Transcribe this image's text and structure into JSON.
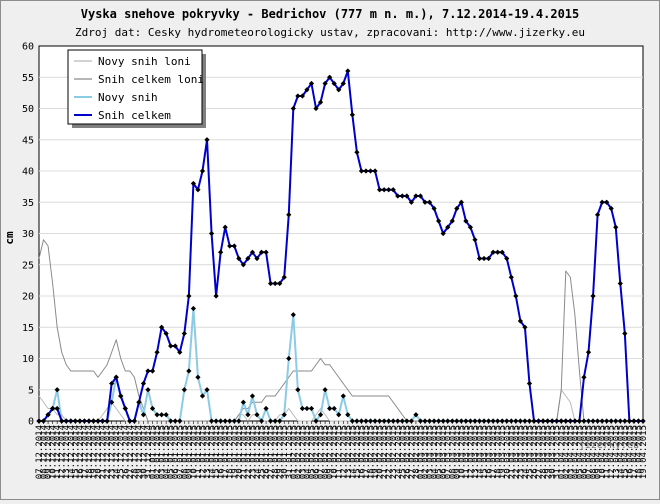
{
  "chart_data": {
    "type": "line",
    "title": "Vyska snehove pokryvky - Bedrichov (777 m n. m.), 7.12.2014-19.4.2015",
    "subtitle": "Zdroj dat: Cesky hydrometeorologicky ustav, zpracovani: http://www.jizerky.eu",
    "ylabel": "cm",
    "xlabel": "",
    "ylim": [
      0,
      60
    ],
    "yticks": [
      0,
      5,
      10,
      15,
      20,
      25,
      30,
      35,
      40,
      45,
      50,
      55,
      60
    ],
    "grid": true,
    "legend_position": "top-left",
    "x_start": "7.12.2014",
    "x_end": "19.4.2015",
    "watermark": "jizerky.eu",
    "legend": [
      {
        "name": "Novy snih loni",
        "color": "#b8b8b8",
        "marker": false
      },
      {
        "name": "Snih celkem loni",
        "color": "#8a8a8a",
        "marker": false
      },
      {
        "name": "Novy snih",
        "color": "#8ccbe6",
        "marker": true
      },
      {
        "name": "Snih celkem",
        "color": "#0000cc",
        "marker": true
      }
    ],
    "series": [
      {
        "name": "Snih celkem",
        "color": "#0000cc",
        "values": [
          0,
          0,
          1,
          2,
          2,
          0,
          0,
          0,
          0,
          0,
          0,
          0,
          0,
          0,
          0,
          0,
          6,
          7,
          4,
          2,
          0,
          0,
          3,
          6,
          8,
          8,
          11,
          15,
          14,
          12,
          12,
          11,
          14,
          20,
          38,
          37,
          40,
          45,
          30,
          20,
          27,
          31,
          28,
          28,
          26,
          25,
          26,
          27,
          26,
          27,
          27,
          22,
          22,
          22,
          23,
          33,
          50,
          52,
          52,
          53,
          54,
          50,
          51,
          54,
          55,
          54,
          53,
          54,
          56,
          49,
          43,
          40,
          40,
          40,
          40,
          37,
          37,
          37,
          37,
          36,
          36,
          36,
          35,
          36,
          36,
          35,
          35,
          34,
          32,
          30,
          31,
          32,
          34,
          35,
          32,
          31,
          29,
          26,
          26,
          26,
          27,
          27,
          27,
          26,
          23,
          20,
          16,
          15,
          6,
          0,
          0,
          0,
          0,
          0,
          0,
          0,
          0,
          0,
          0,
          0,
          7,
          11,
          20,
          33,
          35,
          35,
          34,
          31,
          22,
          14,
          0,
          0,
          0,
          0,
          0,
          0,
          0,
          0,
          0,
          0,
          0,
          0
        ]
      },
      {
        "name": "Novy snih",
        "color": "#8ccbe6",
        "values": [
          0,
          0,
          1,
          2,
          5,
          0,
          0,
          0,
          0,
          0,
          0,
          0,
          0,
          0,
          0,
          0,
          3,
          7,
          4,
          2,
          0,
          0,
          3,
          1,
          5,
          2,
          1,
          1,
          1,
          0,
          0,
          0,
          5,
          8,
          18,
          7,
          4,
          5,
          0,
          0,
          0,
          0,
          0,
          0,
          0,
          3,
          1,
          4,
          1,
          0,
          2,
          0,
          0,
          0,
          1,
          10,
          17,
          5,
          2,
          2,
          2,
          0,
          1,
          5,
          2,
          2,
          1,
          4,
          1,
          0,
          0,
          0,
          0,
          0,
          0,
          0,
          0,
          0,
          0,
          0,
          0,
          0,
          0,
          1,
          0,
          0,
          0,
          0,
          0,
          0,
          0,
          0,
          0,
          0,
          0,
          0,
          0,
          0,
          0,
          0,
          0,
          0,
          0,
          0,
          0,
          0,
          0,
          0,
          0,
          0,
          0,
          0,
          0,
          0,
          0,
          0,
          0,
          0,
          0,
          0,
          0,
          0,
          0,
          0,
          0,
          0,
          0,
          0,
          0,
          0,
          0,
          0,
          0,
          0,
          0,
          0,
          0,
          0,
          0,
          0,
          0,
          0
        ]
      },
      {
        "name": "Snih celkem loni",
        "color": "#8a8a8a",
        "values": [
          26,
          29,
          28,
          22,
          15,
          11,
          9,
          8,
          8,
          8,
          8,
          8,
          8,
          7,
          8,
          9,
          11,
          13,
          10,
          8,
          8,
          7,
          4,
          2,
          0,
          0,
          0,
          0,
          0,
          0,
          0,
          0,
          0,
          0,
          0,
          0,
          0,
          0,
          0,
          0,
          0,
          0,
          0,
          0,
          1,
          2,
          2,
          3,
          3,
          3,
          4,
          4,
          4,
          5,
          6,
          7,
          8,
          8,
          8,
          8,
          8,
          9,
          10,
          9,
          9,
          8,
          7,
          6,
          5,
          4,
          4,
          4,
          4,
          4,
          4,
          4,
          4,
          4,
          3,
          2,
          1,
          0,
          0,
          0,
          0,
          0,
          0,
          0,
          0,
          0,
          0,
          0,
          0,
          0,
          0,
          0,
          0,
          0,
          0,
          0,
          0,
          0,
          0,
          0,
          0,
          0,
          0,
          0,
          0,
          0,
          0,
          0,
          0,
          0,
          0,
          5,
          24,
          23,
          17,
          8,
          0,
          0,
          0,
          0,
          0,
          0,
          0,
          0,
          0,
          0,
          0,
          0,
          0,
          0,
          0,
          0,
          0,
          0,
          0,
          0,
          0,
          0,
          0,
          0
        ]
      },
      {
        "name": "Novy snih loni",
        "color": "#b8b8b8",
        "values": [
          4,
          3,
          2,
          2,
          1,
          1,
          0,
          0,
          0,
          0,
          0,
          0,
          0,
          0,
          1,
          2,
          3,
          2,
          1,
          0,
          0,
          0,
          0,
          0,
          0,
          0,
          0,
          0,
          0,
          0,
          0,
          0,
          0,
          0,
          0,
          0,
          0,
          0,
          0,
          0,
          0,
          0,
          0,
          0,
          1,
          1,
          0,
          1,
          1,
          0,
          0,
          0,
          0,
          1,
          1,
          2,
          1,
          0,
          0,
          0,
          0,
          1,
          2,
          1,
          0,
          0,
          0,
          0,
          0,
          0,
          0,
          0,
          0,
          0,
          0,
          0,
          0,
          0,
          0,
          0,
          0,
          0,
          0,
          0,
          0,
          0,
          0,
          0,
          0,
          0,
          0,
          0,
          0,
          0,
          0,
          0,
          0,
          0,
          0,
          0,
          0,
          0,
          0,
          0,
          0,
          0,
          0,
          0,
          0,
          0,
          0,
          0,
          0,
          0,
          0,
          5,
          4,
          3,
          0,
          0,
          0,
          0,
          0,
          0,
          0,
          0,
          0,
          0,
          0,
          0,
          0,
          0,
          0,
          0,
          0,
          0,
          0,
          0,
          0,
          0,
          0,
          0,
          0
        ]
      }
    ]
  }
}
